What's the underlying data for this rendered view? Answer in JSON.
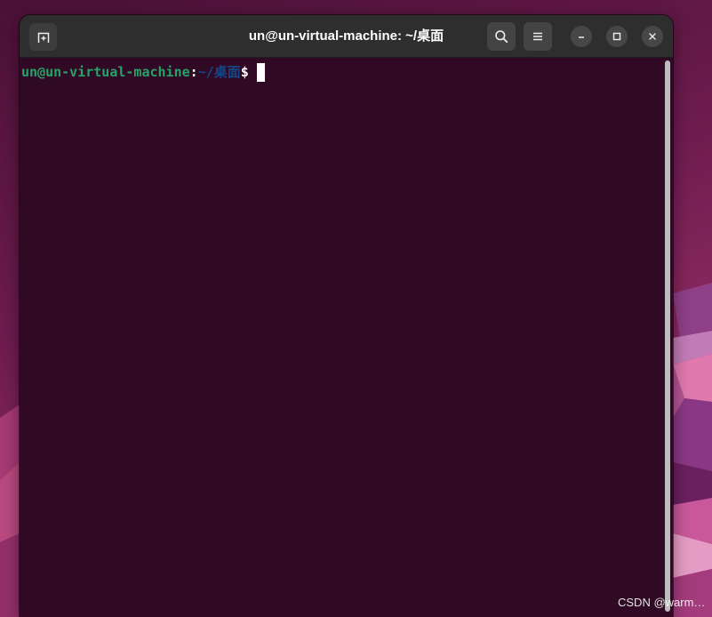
{
  "window": {
    "title": "un@un-virtual-machine: ~/桌面"
  },
  "headerbar": {
    "icons": {
      "new_tab": "tab-new-icon",
      "search": "search-icon",
      "menu": "hamburger-menu-icon",
      "minimize": "minimize-icon",
      "maximize": "maximize-icon",
      "close": "close-icon"
    }
  },
  "terminal": {
    "prompt": {
      "user_host": "un@un-virtual-machine",
      "separator": ":",
      "path": "~/桌面",
      "symbol": "$"
    },
    "scrollbar": {
      "thumb_fraction": 1.0
    }
  },
  "watermark": "CSDN @warm…",
  "colors": {
    "terminal_bg": "#300a24",
    "headerbar_bg": "#2e2e2e",
    "prompt_user": "#26a269",
    "prompt_path": "#12488b",
    "text": "#ffffff"
  }
}
